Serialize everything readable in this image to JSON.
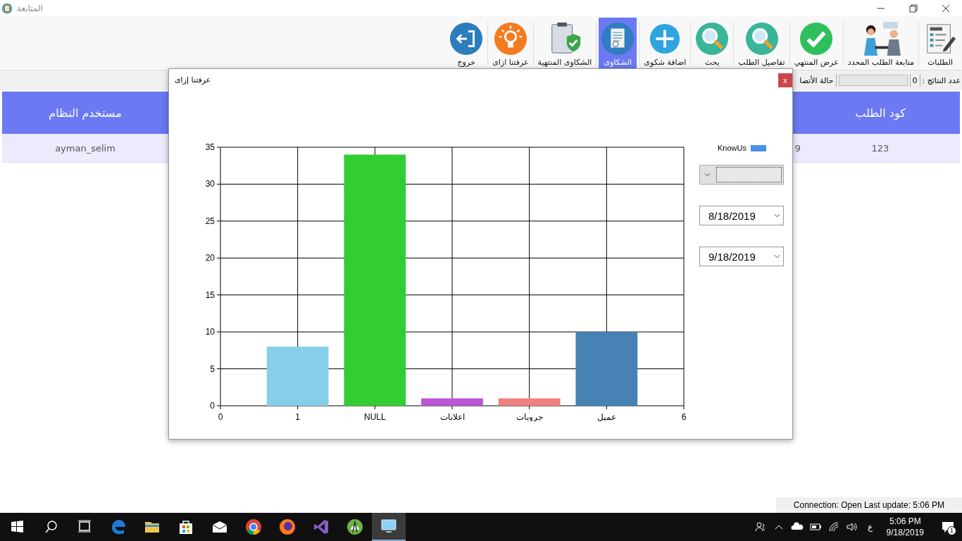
{
  "window": {
    "title": "المتابعة"
  },
  "toolbar": [
    {
      "label": "الطلبات",
      "kind": "order",
      "selected": false
    },
    {
      "label": "متابعة الطلب المحدد",
      "kind": "people",
      "selected": false
    },
    {
      "label": "عرض المنتهي",
      "kind": "check",
      "selected": false
    },
    {
      "label": "تفاصيل الطلب",
      "kind": "search",
      "selected": false
    },
    {
      "label": "بحث",
      "kind": "search",
      "selected": false
    },
    {
      "label": "اضافة شكوى",
      "kind": "plus",
      "selected": false
    },
    {
      "label": "الشكاوى",
      "kind": "doc",
      "selected": true
    },
    {
      "label": "الشكاوى المنتهية",
      "kind": "clipboard",
      "selected": false
    },
    {
      "label": "عرفتنا ازاى",
      "kind": "bulb",
      "selected": false
    },
    {
      "label": "خروج",
      "kind": "exit",
      "selected": false
    }
  ],
  "status_strip": {
    "results_label": "عدد النتائج :",
    "results_count": "0",
    "progress": {
      "level": 0
    },
    "connection_label": "حالة الأتصا"
  },
  "table": {
    "columns": [
      "كود الطلب",
      "مستخدم النظام"
    ],
    "rows": [
      {
        "code": "123",
        "column_2": "9",
        "user": "ayman_selim",
        "selected": true
      }
    ]
  },
  "dialog": {
    "title": "عرفتنا إزاى",
    "close": "x",
    "date_from": "8/18/2019",
    "date_to": "9/18/2019",
    "bars": [
      {
        "color": "#87ceeb"
      },
      {
        "color": "#32cd32"
      },
      {
        "color": "#ba55d3"
      },
      {
        "color": "#f08080"
      },
      {
        "color": "#4682b4"
      }
    ],
    "chart_data": {
      "type": "bar",
      "x": [
        1,
        2,
        3,
        4,
        5
      ],
      "series": [
        {
          "name": "KnowUs",
          "values": [
            8,
            34,
            1,
            1,
            10
          ]
        }
      ],
      "grid": true,
      "xlim": [
        0,
        6
      ],
      "ylim": [
        0,
        35
      ],
      "xticks": [
        0,
        {
          "value": 1,
          "label": "1"
        },
        {
          "value": 2,
          "label": "NULL"
        },
        {
          "value": 3,
          "label": "اعلانات"
        },
        {
          "value": 4,
          "label": "جروبات"
        },
        {
          "value": 5,
          "label": "عميل"
        },
        6
      ],
      "yticks": [
        0,
        5,
        10,
        15,
        20,
        25,
        30,
        35
      ]
    }
  },
  "connection_status": "Connection: Open Last update: 5:06 PM",
  "taskbar": {
    "apps": [
      {
        "kind": "edge",
        "selected": false
      },
      {
        "kind": "folder",
        "selected": false
      },
      {
        "kind": "store",
        "selected": false
      },
      {
        "kind": "mail",
        "selected": false
      },
      {
        "kind": "chrome",
        "selected": false
      },
      {
        "kind": "firefox",
        "selected": false
      },
      {
        "kind": "vs",
        "selected": false
      },
      {
        "kind": "android",
        "selected": false
      },
      {
        "kind": "monitor",
        "selected": true
      }
    ],
    "language": "ع",
    "time": "5:06 PM",
    "date": "9/18/2019",
    "notifications": "1"
  }
}
